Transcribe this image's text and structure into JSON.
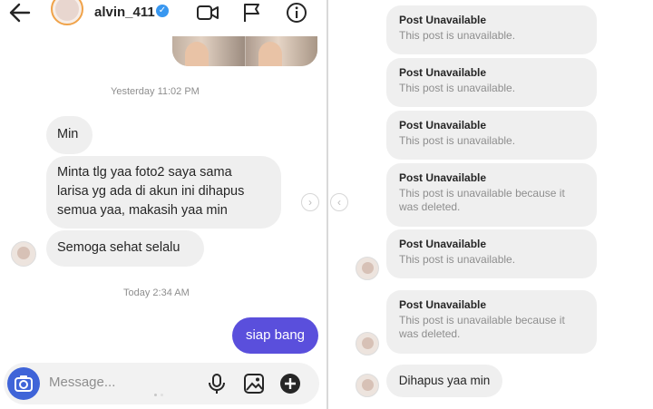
{
  "header": {
    "back_icon": "back-arrow-icon",
    "username": "alvin_411",
    "verified_icon": "verified-badge-icon",
    "icons": [
      "video-call-icon",
      "flag-icon",
      "info-icon"
    ]
  },
  "left_thread": {
    "timestamp_1": "Yesterday 11:02 PM",
    "received": [
      {
        "text": "Min"
      },
      {
        "lines": [
          "Minta tlg yaa foto2 saya sama",
          "larisa yg  ada di akun ini dihapus",
          "semua yaa, makasih yaa min"
        ]
      },
      {
        "text": "Semoga sehat selalu"
      }
    ],
    "timestamp_2": "Today 2:34 AM",
    "sent": {
      "text": "siap bang"
    }
  },
  "composer": {
    "placeholder": "Message...",
    "camera_icon": "camera-icon",
    "icons": [
      "microphone-icon",
      "gallery-icon",
      "add-icon"
    ]
  },
  "nav": {
    "next_icon": "chevron-right-icon",
    "prev_icon": "chevron-left-icon"
  },
  "right_thread": {
    "cards": [
      {
        "title": "Post Unavailable",
        "body": [
          "This post is unavailable."
        ]
      },
      {
        "title": "Post Unavailable",
        "body": [
          "This post is unavailable."
        ]
      },
      {
        "title": "Post Unavailable",
        "body": [
          "This post is unavailable."
        ]
      },
      {
        "title": "Post Unavailable",
        "body": [
          "This post is unavailable because it",
          "was deleted."
        ]
      },
      {
        "title": "Post Unavailable",
        "body": [
          "This post is unavailable."
        ]
      },
      {
        "title": "Post Unavailable",
        "body": [
          "This post is unavailable because it",
          "was deleted."
        ]
      }
    ],
    "last_message": "Dihapus yaa min"
  },
  "colors": {
    "accent": "#5a4fdc",
    "camera": "#3f64d8",
    "bubble": "#efefef",
    "muted": "#8e8e8e",
    "verified": "#3897f0"
  }
}
